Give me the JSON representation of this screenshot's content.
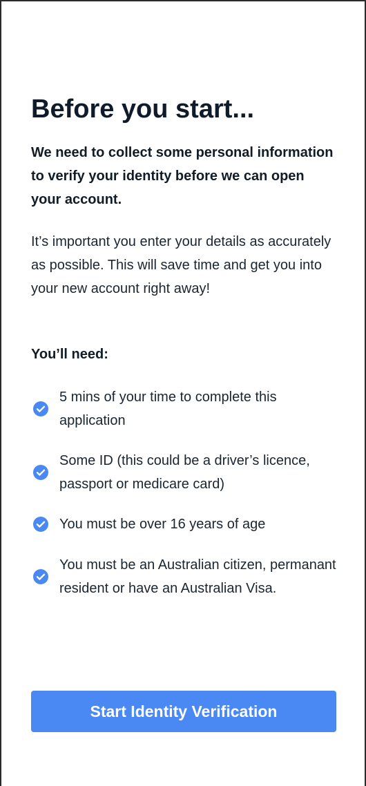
{
  "title": "Before you start...",
  "intro_bold": "We need to collect some personal information to verify your identity before we can open your account.",
  "intro": "It’s important you enter your details as accurately as possible. This will save time and get you into your new account right away!",
  "requirements_heading": "You’ll need:",
  "requirements": [
    {
      "icon": "check-circle-icon",
      "text": "5 mins of your time to complete this application"
    },
    {
      "icon": "check-circle-icon",
      "text": "Some ID (this could be a driver’s licence, passport or medicare card)"
    },
    {
      "icon": "check-circle-icon",
      "text": "You must be over 16 years of age"
    },
    {
      "icon": "check-circle-icon",
      "text": "You must be an Australian citizen, permanant resident or have an Australian Visa."
    }
  ],
  "cta_label": "Start Identity Verification",
  "colors": {
    "accent": "#4a88f3",
    "text": "#111c26"
  }
}
